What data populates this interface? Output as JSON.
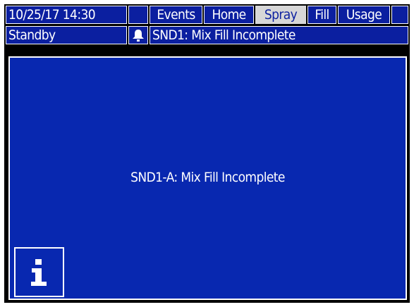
{
  "header": {
    "datetime": "10/25/17 14:30",
    "tabs": [
      {
        "label": "Events",
        "active": false
      },
      {
        "label": "Home",
        "active": false
      },
      {
        "label": "Spray",
        "active": true
      },
      {
        "label": "Fill",
        "active": false
      },
      {
        "label": "Usage",
        "active": false
      }
    ]
  },
  "status": {
    "state": "Standby",
    "alert_icon": "bell-alarm-icon",
    "alert_text": "SND1: Mix Fill Incomplete"
  },
  "main": {
    "message": "SND1-A: Mix Fill Incomplete",
    "info_icon": "info-icon"
  },
  "colors": {
    "screen_blue": "#0828b0",
    "cell_blue": "#0b1fa0",
    "active_tab": "#d7d7d7"
  }
}
